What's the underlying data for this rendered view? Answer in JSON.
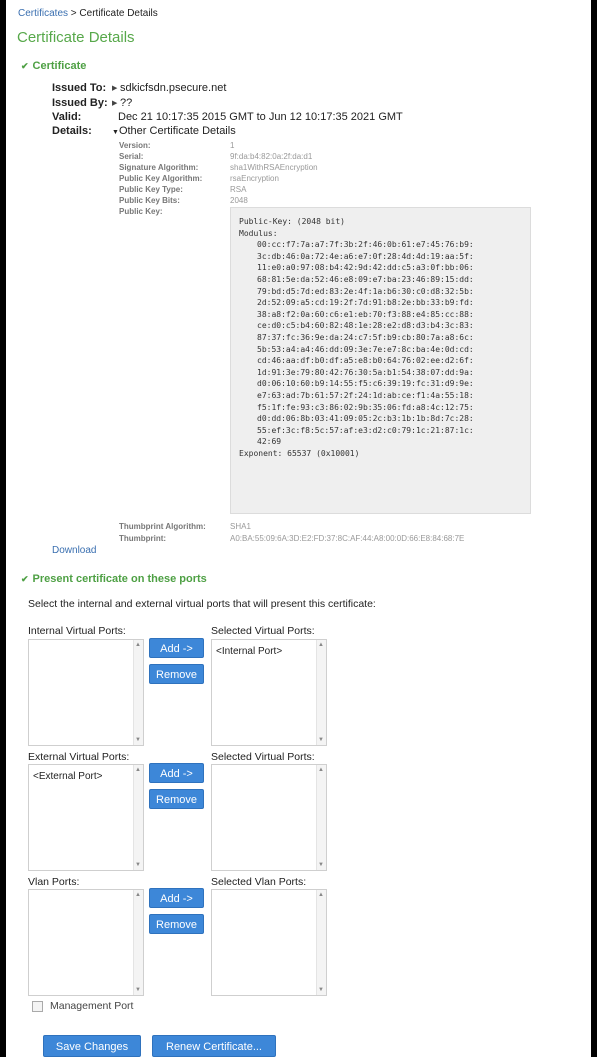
{
  "breadcrumb": {
    "parent": "Certificates",
    "separator": ">",
    "current": "Certificate Details"
  },
  "page_title": "Certificate Details",
  "certificate_section": {
    "title": "Certificate",
    "issued_to_label": "Issued To:",
    "issued_to_value": "sdkicfsdn.psecure.net",
    "issued_by_label": "Issued By:",
    "issued_by_value": "??",
    "valid_label": "Valid:",
    "valid_value": "Dec 21 10:17:35 2015 GMT to Jun 12 10:17:35 2021 GMT",
    "details_label": "Details:",
    "details_toggle": "Other Certificate Details",
    "details": [
      {
        "label": "Version:",
        "value": "1"
      },
      {
        "label": "Serial:",
        "value": "9f:da:b4:82:0a:2f:da:d1"
      },
      {
        "label": "Signature Algorithm:",
        "value": "sha1WithRSAEncryption"
      },
      {
        "label": "Public Key Algorithm:",
        "value": "rsaEncryption"
      },
      {
        "label": "Public Key Type:",
        "value": "RSA"
      },
      {
        "label": "Public Key Bits:",
        "value": "2048"
      },
      {
        "label": "Public Key:",
        "value": ""
      }
    ],
    "public_key": {
      "header": "Public-Key: (2048 bit)",
      "modulus_label": "Modulus:",
      "modulus_lines": [
        "00:cc:f7:7a:a7:7f:3b:2f:46:0b:61:e7:45:76:b9:",
        "3c:db:46:0a:72:4e:a6:e7:0f:28:4d:4d:19:aa:5f:",
        "11:e0:a0:97:08:b4:42:9d:42:dd:c5:a3:0f:bb:06:",
        "68:81:5e:da:52:46:e8:09:e7:ba:23:46:89:15:dd:",
        "79:bd:d5:7d:ed:83:2e:4f:1a:b6:30:c0:d8:32:5b:",
        "2d:52:09:a5:cd:19:2f:7d:91:b8:2e:bb:33:b9:fd:",
        "38:a8:f2:0a:60:c6:e1:eb:70:f3:88:e4:85:cc:88:",
        "ce:d0:c5:b4:60:82:48:1e:28:e2:d8:d3:b4:3c:83:",
        "87:37:fc:36:9e:da:24:c7:5f:b9:cb:80:7a:a8:6c:",
        "5b:53:a4:a4:46:dd:09:3e:7e:e7:8c:ba:4e:0d:cd:",
        "cd:46:aa:df:b0:df:a5:e8:b0:64:76:02:ee:d2:6f:",
        "1d:91:3e:79:80:42:76:30:5a:b1:54:38:07:dd:9a:",
        "d0:06:10:60:b9:14:55:f5:c6:39:19:fc:31:d9:9e:",
        "e7:63:ad:7b:61:57:2f:24:1d:ab:ce:f1:4a:55:18:",
        "f5:1f:fe:93:c3:86:02:9b:35:06:fd:a8:4c:12:75:",
        "d0:dd:06:8b:03:41:09:05:2c:b3:1b:1b:8d:7c:28:",
        "55:ef:3c:f8:5c:57:af:e3:d2:c0:79:1c:21:87:1c:",
        "42:69"
      ],
      "exponent": "Exponent: 65537 (0x10001)"
    },
    "thumbprint_algorithm_label": "Thumbprint Algorithm:",
    "thumbprint_algorithm_value": "SHA1",
    "thumbprint_label": "Thumbprint:",
    "thumbprint_value": "A0:BA:55:09:6A:3D:E2:FD:37:8C:AF:44:A8:00:0D:66:E8:84:68:7E",
    "download_link": "Download"
  },
  "ports_section": {
    "title": "Present certificate on these ports",
    "instruction": "Select the internal and external virtual ports that will present this certificate:",
    "groups": [
      {
        "available_label": "Internal Virtual Ports:",
        "available_items": [],
        "selected_label": "Selected Virtual Ports:",
        "selected_items": [
          "<Internal Port>"
        ],
        "add_label": "Add ->",
        "remove_label": "Remove"
      },
      {
        "available_label": "External Virtual Ports:",
        "available_items": [
          "<External Port>"
        ],
        "selected_label": "Selected Virtual Ports:",
        "selected_items": [],
        "add_label": "Add ->",
        "remove_label": "Remove"
      },
      {
        "available_label": "Vlan Ports:",
        "available_items": [],
        "selected_label": "Selected Vlan Ports:",
        "selected_items": [],
        "add_label": "Add ->",
        "remove_label": "Remove"
      }
    ],
    "management_port_label": "Management Port",
    "management_port_checked": false
  },
  "actions": {
    "save_label": "Save Changes",
    "renew_label": "Renew Certificate..."
  },
  "colors": {
    "accent_green": "#4ea044",
    "link_blue": "#3a6fb0",
    "button_blue": "#3d87d8"
  }
}
